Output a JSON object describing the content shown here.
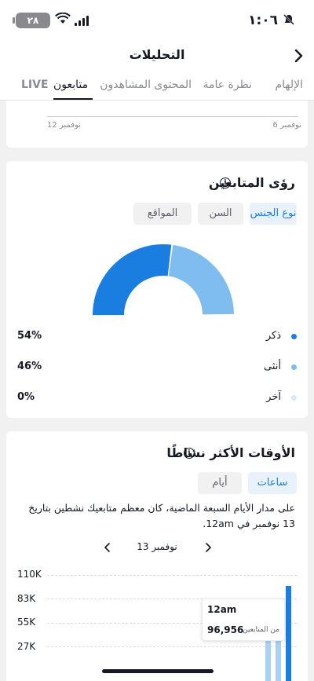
{
  "status_bar": {
    "time": "١:٠٦",
    "battery": "٢٨",
    "icons": [
      "bell-muted-icon",
      "battery-icon",
      "wifi-icon",
      "signal-icon"
    ]
  },
  "header": {
    "title": "التحليلات",
    "back_icon": "chevron-right-icon"
  },
  "tabs": [
    {
      "label": "الإلهام",
      "active": false
    },
    {
      "label": "نظرة عامة",
      "active": false
    },
    {
      "label": "المحتوى",
      "active": false
    },
    {
      "label": "المشاهدون",
      "active": false
    },
    {
      "label": "متابعون",
      "active": true
    },
    {
      "label": "LIVE",
      "active": false
    }
  ],
  "top_chart": {
    "x_start": "نوفمبر 6",
    "x_end": "نوفمبر 12"
  },
  "follower_insights": {
    "title": "رؤى المتابعين",
    "info_icon": "info-icon",
    "filters": [
      {
        "label": "نوع الجنس",
        "selected": true
      },
      {
        "label": "السن",
        "selected": false
      },
      {
        "label": "المواقع",
        "selected": false
      }
    ],
    "gender": [
      {
        "label": "ذكر",
        "value": "54%",
        "color": "#1a7de0"
      },
      {
        "label": "أنثى",
        "value": "46%",
        "color": "#7fbcef"
      },
      {
        "label": "آخر",
        "value": "0%",
        "color": "#d6e9fa"
      }
    ]
  },
  "active_times": {
    "title": "الأوقات الأكثر نشاطًا",
    "info_icon": "info-icon",
    "filters": [
      {
        "label": "ساعات",
        "selected": true
      },
      {
        "label": "أيام",
        "selected": false
      }
    ],
    "description": "على مدار الأيام السبعة الماضية، كان معظم متابعيك نشطين بتاريخ 13 نوفمبر في 12am.",
    "date": "13 نوفمبر",
    "y_ticks": [
      "110K",
      "83K",
      "55K",
      "27K"
    ],
    "tooltip": {
      "time": "12am",
      "count": "96,956",
      "label": "من المتابعين"
    }
  },
  "chart_data": {
    "type": "bar",
    "x": [
      "12am"
    ],
    "values": [
      96956
    ],
    "ylabel": "",
    "yticks": [
      27000,
      55000,
      83000,
      110000
    ],
    "ylim": [
      0,
      110000
    ]
  }
}
